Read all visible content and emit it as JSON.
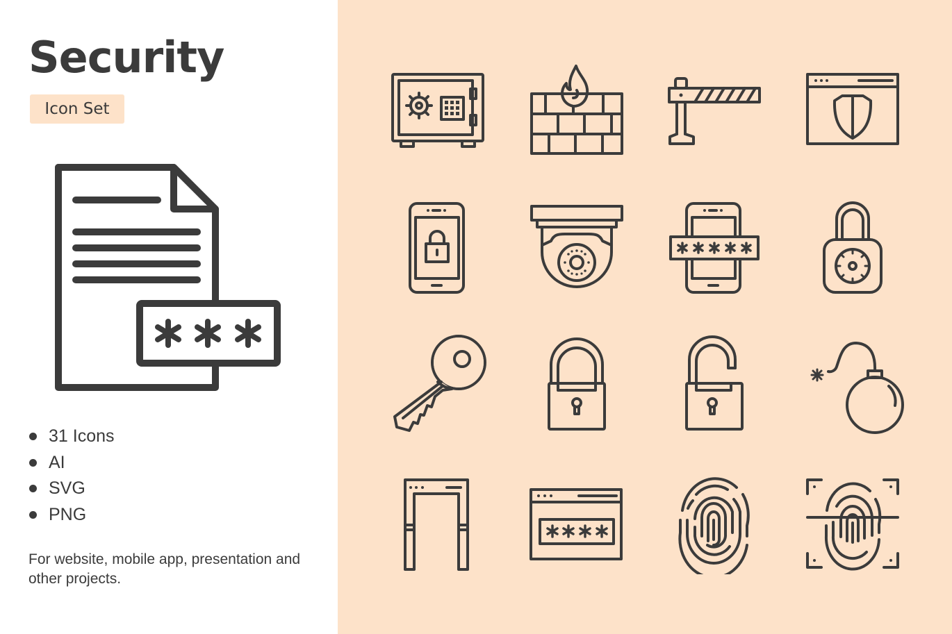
{
  "header": {
    "title": "Security",
    "subtitle": "Icon Set"
  },
  "features": [
    "31 Icons",
    "AI",
    "SVG",
    "PNG"
  ],
  "description": "For website, mobile app, presentation and other projects.",
  "colors": {
    "accent_background": "#fde2c9",
    "ink": "#3b3b3b",
    "panel_background": "#ffffff"
  },
  "hero_icon": {
    "name": "password-document-icon",
    "masked_text": "***"
  },
  "icon_grid": {
    "rows": 4,
    "columns": 4,
    "icons": [
      "safe-icon",
      "firewall-icon",
      "barrier-gate-icon",
      "browser-shield-icon",
      "mobile-lock-icon",
      "security-camera-icon",
      "mobile-password-icon",
      "combination-padlock-icon",
      "key-icon",
      "padlock-locked-icon",
      "padlock-unlocked-icon",
      "bomb-icon",
      "metal-detector-gate-icon",
      "browser-password-icon",
      "fingerprint-icon",
      "fingerprint-scan-icon"
    ]
  }
}
